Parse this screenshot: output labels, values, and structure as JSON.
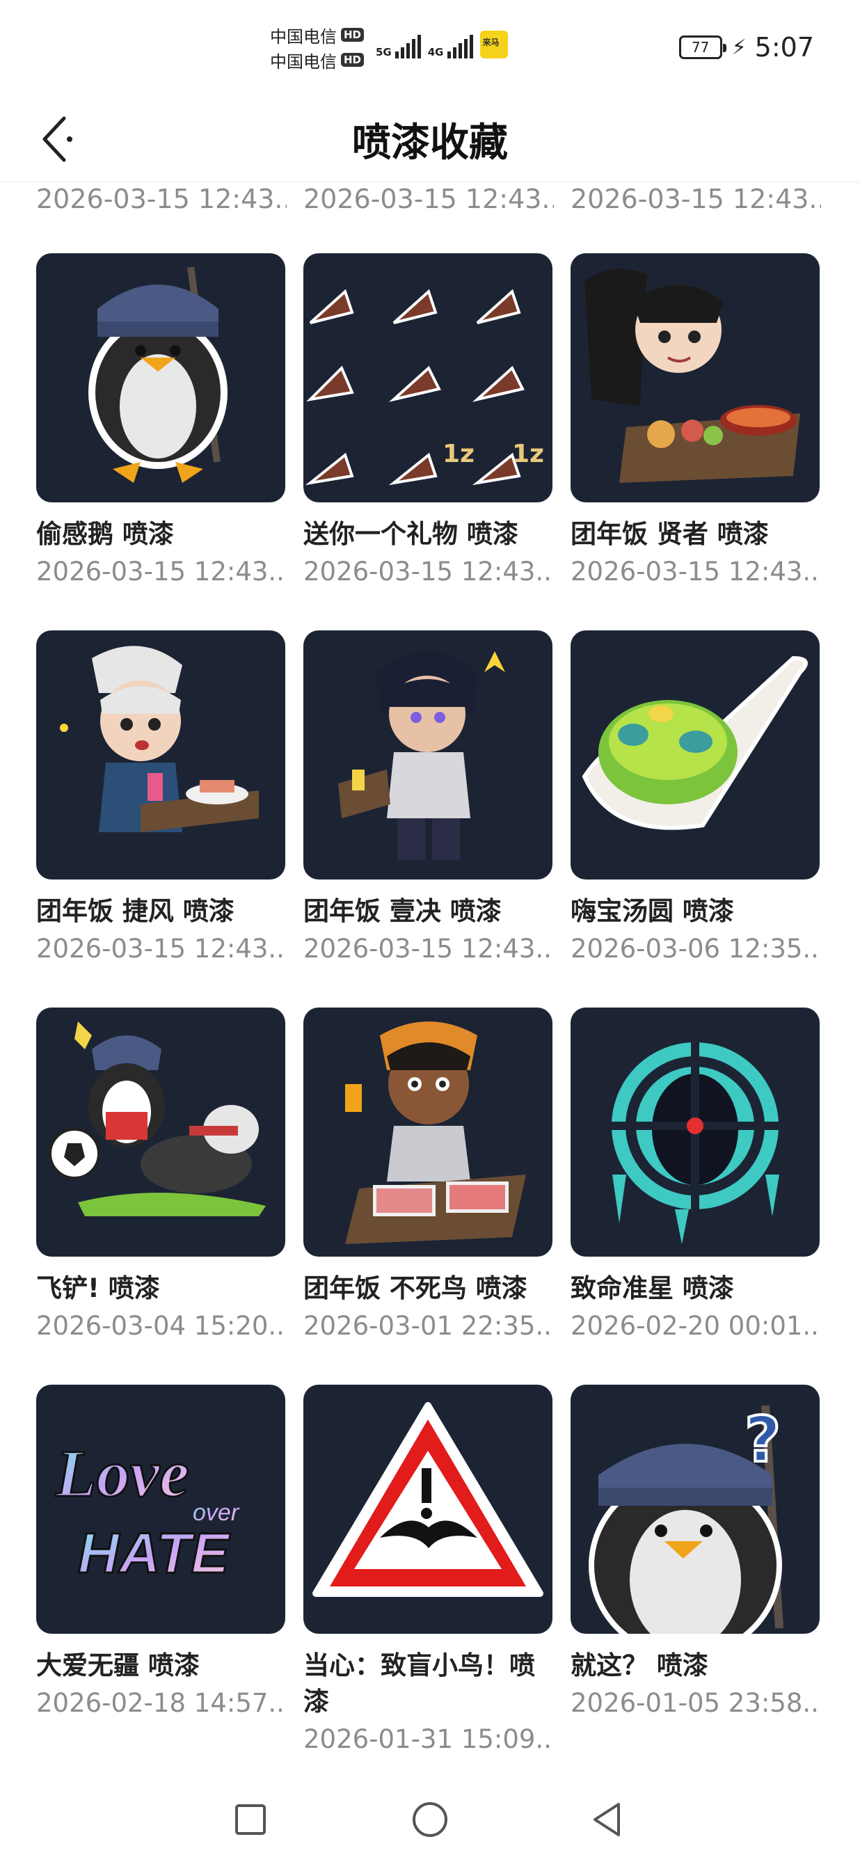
{
  "status_bar": {
    "carrier_1": "中国电信",
    "carrier_2": "中国电信",
    "hd_label": "HD",
    "signal_1_type": "5G",
    "signal_2_type": "4G",
    "app_icon_text": "来马",
    "battery": "77",
    "time": "5:07"
  },
  "header": {
    "title": "喷漆收藏",
    "back_icon": "chevron-left-icon"
  },
  "partial_row": {
    "dates": [
      "2026-03-15 12:43...",
      "2026-03-15 12:43...",
      "2026-03-15 12:43..."
    ]
  },
  "items": [
    {
      "title": "偷感鹅 喷漆",
      "date": "2026-03-15 12:43...",
      "art": "penguin-hat"
    },
    {
      "title": "送你一个礼物 喷漆",
      "date": "2026-03-15 12:43...",
      "art": "cones"
    },
    {
      "title": "团年饭 贤者 喷漆",
      "date": "2026-03-15 12:43...",
      "art": "sage-hotpot"
    },
    {
      "title": "团年饭 捷风 喷漆",
      "date": "2026-03-15 12:43...",
      "art": "jett-dinner"
    },
    {
      "title": "团年饭 壹决 喷漆",
      "date": "2026-03-15 12:43...",
      "art": "iso-dinner"
    },
    {
      "title": "嗨宝汤圆 喷漆",
      "date": "2026-03-06 12:35...",
      "art": "spoon-dumpling"
    },
    {
      "title": "飞铲! 喷漆",
      "date": "2026-03-04 15:20...",
      "art": "penguin-soccer"
    },
    {
      "title": "团年饭 不死鸟 喷漆",
      "date": "2026-03-01 22:35...",
      "art": "phoenix-dinner"
    },
    {
      "title": "致命准星 喷漆",
      "date": "2026-02-20 00:01...",
      "art": "crosshair"
    },
    {
      "title": "大爱无疆 喷漆",
      "date": "2026-02-18 14:57...",
      "art": "love-over-hate"
    },
    {
      "title": "当心：致盲小鸟！喷漆",
      "date": "2026-01-31 15:09...",
      "art": "warning-bird"
    },
    {
      "title": "就这？ 喷漆",
      "date": "2026-01-05 23:58...",
      "art": "penguin-question"
    }
  ],
  "art_text": {
    "love": "Love",
    "over": "over",
    "hate": "HATE",
    "one_z": "1z",
    "question": "?"
  },
  "nav_bar": {
    "recents_icon": "square-icon",
    "home_icon": "circle-icon",
    "back_icon": "triangle-back-icon"
  },
  "colors": {
    "thumb_bg": "#1c2434",
    "date_text": "#8c8c8c",
    "title_text": "#222222"
  }
}
